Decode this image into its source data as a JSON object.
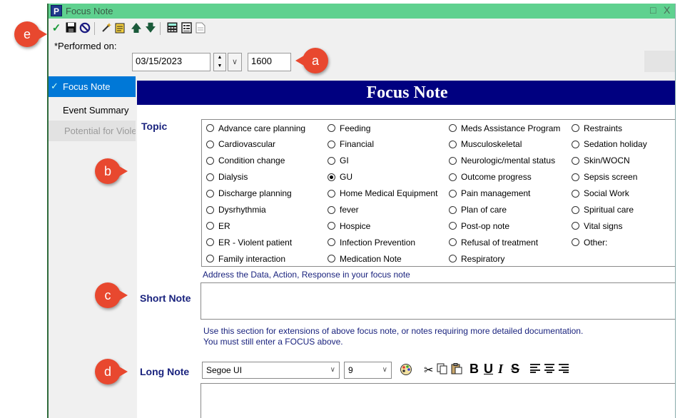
{
  "window": {
    "title": "Focus Note",
    "app_icon_letter": "P",
    "restore_glyph": "□",
    "close_glyph": "X"
  },
  "toolbar": {
    "icons": [
      "sign-icon",
      "save-icon",
      "cancel-icon",
      "wand-icon",
      "template-icon",
      "up-arrow-icon",
      "down-arrow-icon",
      "calculator-icon",
      "notes-icon",
      "document-icon"
    ]
  },
  "performed_on": {
    "label": "*Performed on:",
    "date": "03/15/2023",
    "time": "1600"
  },
  "sidebar": {
    "items": [
      {
        "label": "Focus Note",
        "state": "active"
      },
      {
        "label": "Event Summary",
        "state": "normal"
      },
      {
        "label": "Potential for Viole",
        "state": "disabled"
      }
    ]
  },
  "form": {
    "header": "Focus Note",
    "topic_label": "Topic",
    "topics": {
      "col1": [
        "Advance care planning",
        "Cardiovascular",
        "Condition change",
        "Dialysis",
        "Discharge planning",
        "Dysrhythmia",
        "ER",
        "ER - Violent patient",
        "Family interaction"
      ],
      "col2": [
        "Feeding",
        "Financial",
        "GI",
        "GU",
        "Home Medical Equipment",
        "fever",
        "Hospice",
        "Infection Prevention",
        "Medication Note"
      ],
      "col3": [
        "Meds Assistance Program",
        "Musculoskeletal",
        "Neurologic/mental status",
        "Outcome progress",
        "Pain management",
        "Plan of care",
        "Post-op note",
        "Refusal of treatment",
        "Respiratory"
      ],
      "col4": [
        "Restraints",
        "Sedation holiday",
        "Skin/WOCN",
        "Sepsis screen",
        "Social Work",
        "Spiritual care",
        "Vital signs",
        "Other:"
      ]
    },
    "selected_topic": "GU",
    "short_note_hint": "Address the Data, Action, Response in your focus note",
    "short_note_label": "Short Note",
    "long_note_hint_1": "Use this section for extensions of above focus note, or notes requiring more detailed documentation.",
    "long_note_hint_2": "You must still enter a FOCUS above.",
    "long_note_label": "Long Note",
    "font_name": "Segoe UI",
    "font_size": "9",
    "format_buttons": {
      "bold": "B",
      "underline": "U",
      "italic": "I",
      "strike": "S"
    }
  },
  "callouts": {
    "a": "a",
    "b": "b",
    "c": "c",
    "d": "d",
    "e": "e"
  },
  "colors": {
    "titlebar": "#5fd18f",
    "header": "#000080",
    "label": "#1a237e",
    "callout": "#e8482f",
    "sidebar_active": "#0078d7"
  }
}
